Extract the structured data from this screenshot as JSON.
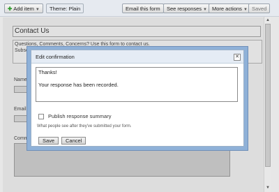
{
  "toolbar": {
    "add_item": "Add item",
    "theme": "Theme: Plain",
    "email_form": "Email this form",
    "see_responses": "See responses",
    "more_actions": "More actions",
    "saved": "Saved"
  },
  "form": {
    "title": "Contact Us",
    "description_line1": "Questions, Comments, Concerns? Use this form to contact us.",
    "description_line2": "Subsc",
    "field1_label": "Name",
    "field2_label": "Email",
    "field3_label": "Comm"
  },
  "dialog": {
    "title": "Edit confirmation",
    "close_symbol": "✕",
    "message_line1": "Thanks!",
    "message_line2": "Your response has been recorded.",
    "checkbox_label": "Publish response summary",
    "hint": "What people see after they've submitted your form.",
    "save": "Save",
    "cancel": "Cancel"
  }
}
